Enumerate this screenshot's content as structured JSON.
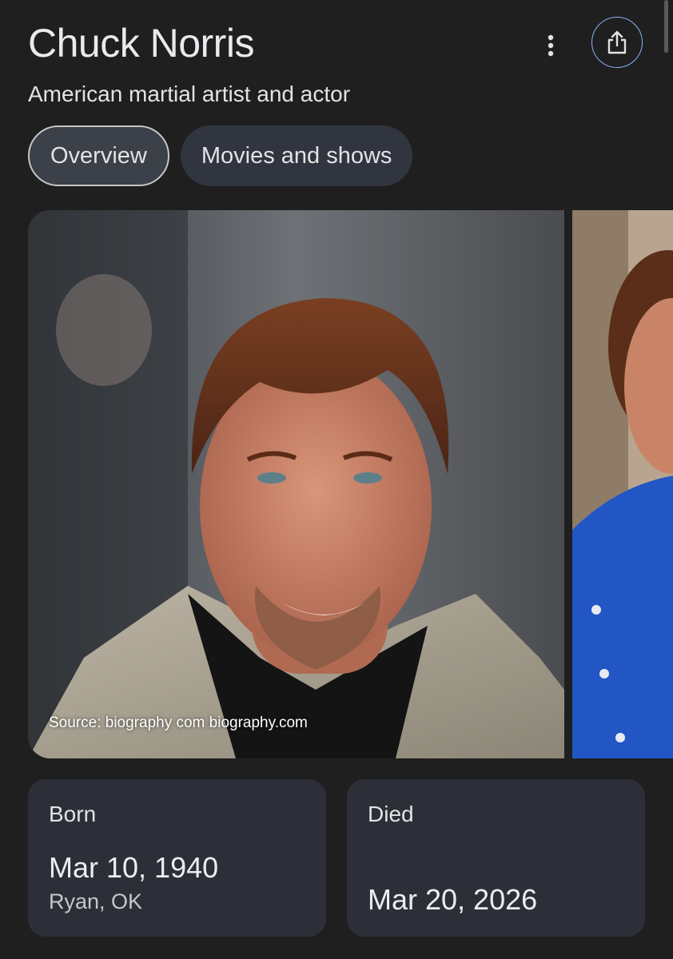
{
  "header": {
    "title": "Chuck Norris",
    "subtitle": "American martial artist and actor",
    "more_icon": "more-vert-icon",
    "share_icon": "share-icon",
    "accent_color": "#8ab4f8"
  },
  "tabs": [
    {
      "label": "Overview",
      "active": true
    },
    {
      "label": "Movies and shows",
      "active": false
    }
  ],
  "images": {
    "main_source": "Source: biography com biography.com"
  },
  "facts": {
    "born": {
      "label": "Born",
      "date": "Mar 10, 1940",
      "place": "Ryan, OK"
    },
    "died": {
      "label": "Died",
      "date": "Mar 20, 2026"
    }
  }
}
